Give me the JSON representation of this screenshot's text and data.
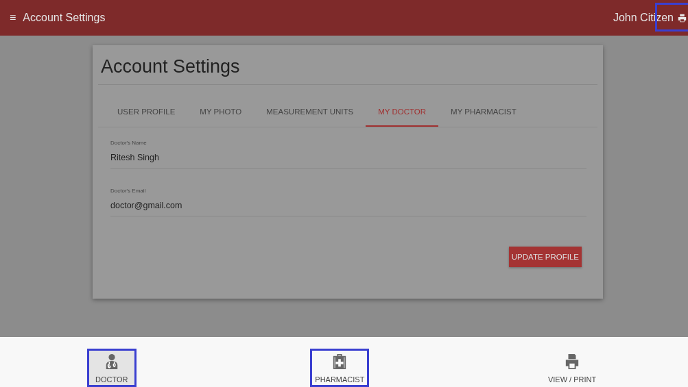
{
  "header": {
    "menu_glyph": "≡",
    "title": "Account Settings",
    "user": "John Citizen",
    "print_highlighted": true
  },
  "card": {
    "title": "Account Settings",
    "tabs": [
      {
        "label": "USER PROFILE",
        "selected": false
      },
      {
        "label": "MY PHOTO",
        "selected": false
      },
      {
        "label": "MEASUREMENT UNITS",
        "selected": false
      },
      {
        "label": "MY DOCTOR",
        "selected": true
      },
      {
        "label": "MY PHARMACIST",
        "selected": false
      }
    ],
    "fields": [
      {
        "label": "Doctor's Name",
        "value": "Ritesh Singh"
      },
      {
        "label": "Doctor's Email",
        "value": "doctor@gmail.com"
      }
    ],
    "button": "UPDATE PROFILE"
  },
  "bottom_nav": [
    {
      "kind": "doctor",
      "label": "DOCTOR",
      "selected": true,
      "highlighted": true
    },
    {
      "kind": "pharmacist",
      "label": "PHARMACIST",
      "selected": false,
      "highlighted": true
    },
    {
      "kind": "print",
      "label": "VIEW / PRINT",
      "selected": false,
      "highlighted": false
    }
  ]
}
